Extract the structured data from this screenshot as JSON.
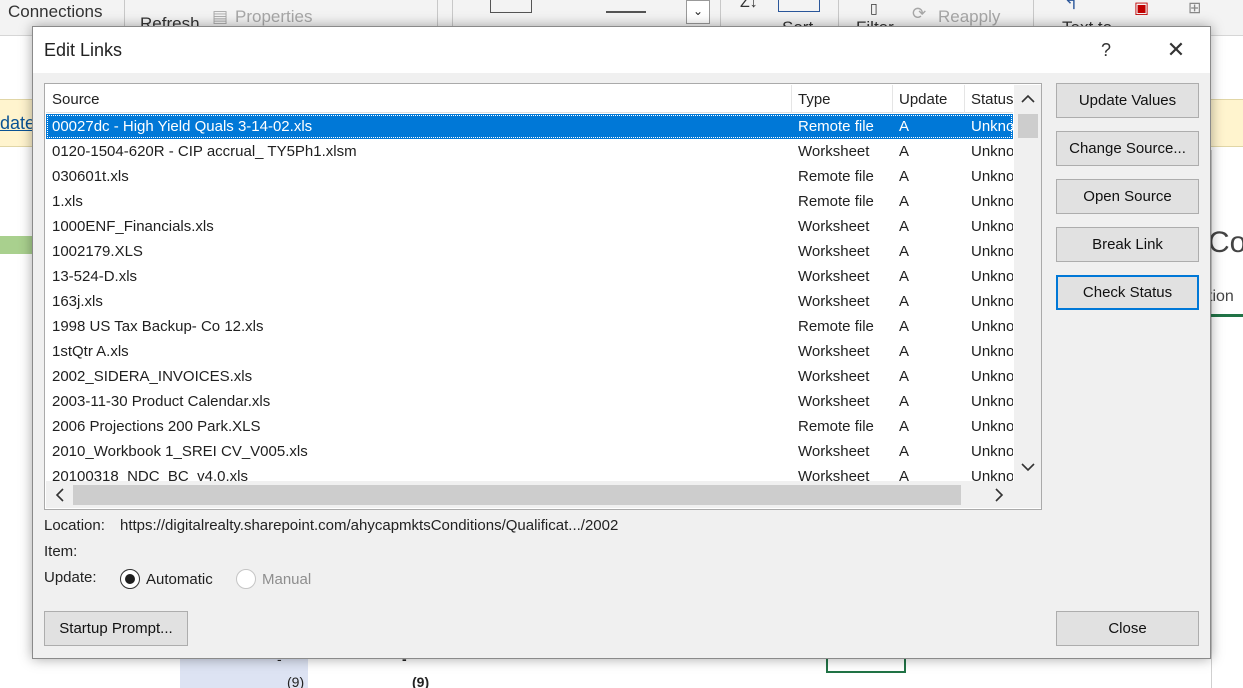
{
  "background": {
    "ribbon": {
      "connections_label": "Connections",
      "properties_label": "Properties",
      "reapply_label": "Reapply",
      "refresh_label": "Refresh",
      "sort_label": "Sort",
      "filter_label": "Filter",
      "text_to_label": "Text to"
    },
    "notice_link": "date",
    "panel_heading_fragment": "Co",
    "panel_tab_fragment": "tion",
    "cell_values": [
      "-",
      "-",
      "(9)",
      "(9)"
    ]
  },
  "dialog": {
    "title": "Edit Links",
    "help_label": "?",
    "close_glyph": "✕",
    "columns": {
      "source": "Source",
      "type": "Type",
      "update": "Update",
      "status": "Status"
    },
    "links": [
      {
        "source": "00027dc - High Yield Quals 3-14-02.xls",
        "type": "Remote file",
        "update": "A",
        "status": "Unkno",
        "selected": true
      },
      {
        "source": "0120-1504-620R - CIP accrual_ TY5Ph1.xlsm",
        "type": "Worksheet",
        "update": "A",
        "status": "Unkno"
      },
      {
        "source": "030601t.xls",
        "type": "Remote file",
        "update": "A",
        "status": "Unkno"
      },
      {
        "source": "1.xls",
        "type": "Remote file",
        "update": "A",
        "status": "Unkno"
      },
      {
        "source": "1000ENF_Financials.xls",
        "type": "Worksheet",
        "update": "A",
        "status": "Unkno"
      },
      {
        "source": "1002179.XLS",
        "type": "Worksheet",
        "update": "A",
        "status": "Unkno"
      },
      {
        "source": "13-524-D.xls",
        "type": "Worksheet",
        "update": "A",
        "status": "Unkno"
      },
      {
        "source": "163j.xls",
        "type": "Worksheet",
        "update": "A",
        "status": "Unkno"
      },
      {
        "source": "1998 US Tax Backup- Co 12.xls",
        "type": "Remote file",
        "update": "A",
        "status": "Unkno"
      },
      {
        "source": "1stQtr A.xls",
        "type": "Worksheet",
        "update": "A",
        "status": "Unkno"
      },
      {
        "source": "2002_SIDERA_INVOICES.xls",
        "type": "Worksheet",
        "update": "A",
        "status": "Unkno"
      },
      {
        "source": "2003-11-30 Product Calendar.xls",
        "type": "Worksheet",
        "update": "A",
        "status": "Unkno"
      },
      {
        "source": "2006 Projections 200 Park.XLS",
        "type": "Remote file",
        "update": "A",
        "status": "Unkno"
      },
      {
        "source": "2010_Workbook 1_SREI CV_V005.xls",
        "type": "Worksheet",
        "update": "A",
        "status": "Unkno"
      },
      {
        "source": "20100318_NDC_BC_v4.0.xls",
        "type": "Worksheet",
        "update": "A",
        "status": "Unkno"
      }
    ],
    "buttons": {
      "update_values": "Update Values",
      "change_source": "Change Source...",
      "open_source": "Open Source",
      "break_link": "Break Link",
      "check_status": "Check Status",
      "startup_prompt": "Startup Prompt...",
      "close": "Close"
    },
    "details": {
      "location_label": "Location:",
      "location_value": "https://digitalrealty.sharepoint.com/ahycapmktsConditions/Qualificat.../2002",
      "item_label": "Item:",
      "update_label": "Update:",
      "automatic_label": "Automatic",
      "manual_label": "Manual",
      "selected_mode": "Automatic"
    }
  }
}
